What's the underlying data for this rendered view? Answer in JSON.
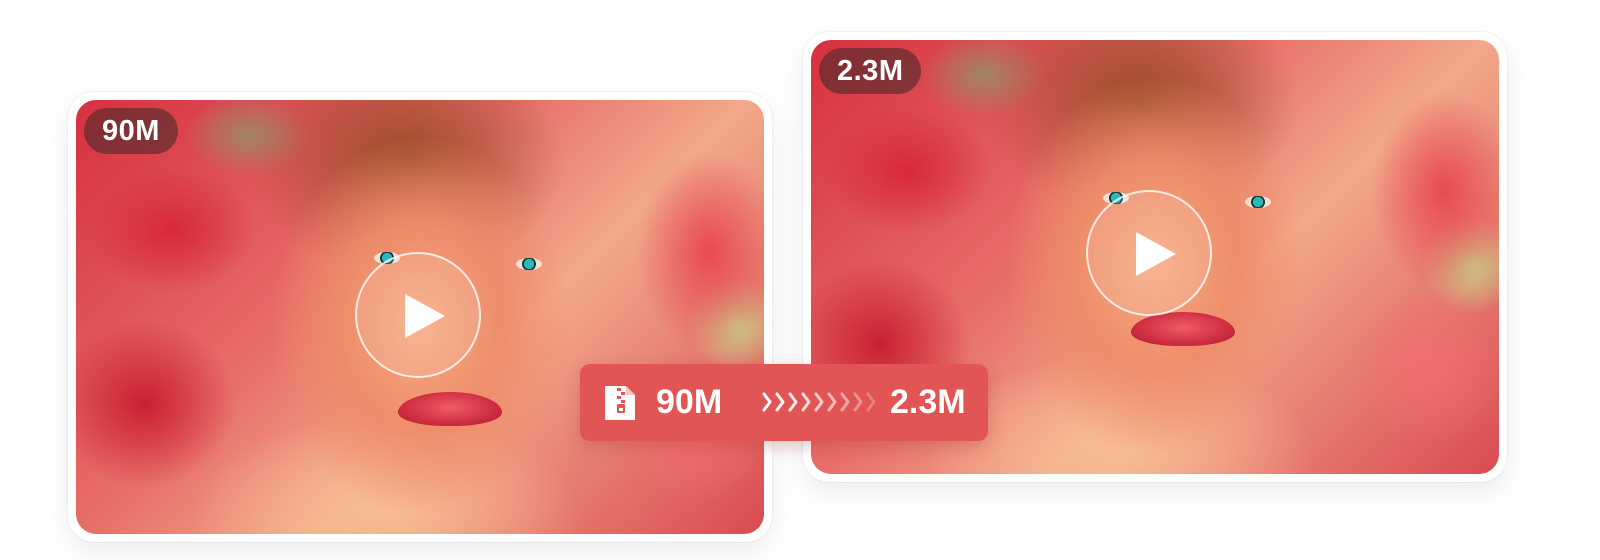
{
  "original": {
    "size_label": "90M",
    "play_icon": "play-icon"
  },
  "compressed": {
    "size_label": "2.3M",
    "play_icon": "play-icon"
  },
  "banner": {
    "icon": "zip-file-icon",
    "from_size": "90M",
    "to_size": "2.3M",
    "arrow_icon": "chevron-arrows-icon",
    "color": "#e25555"
  }
}
